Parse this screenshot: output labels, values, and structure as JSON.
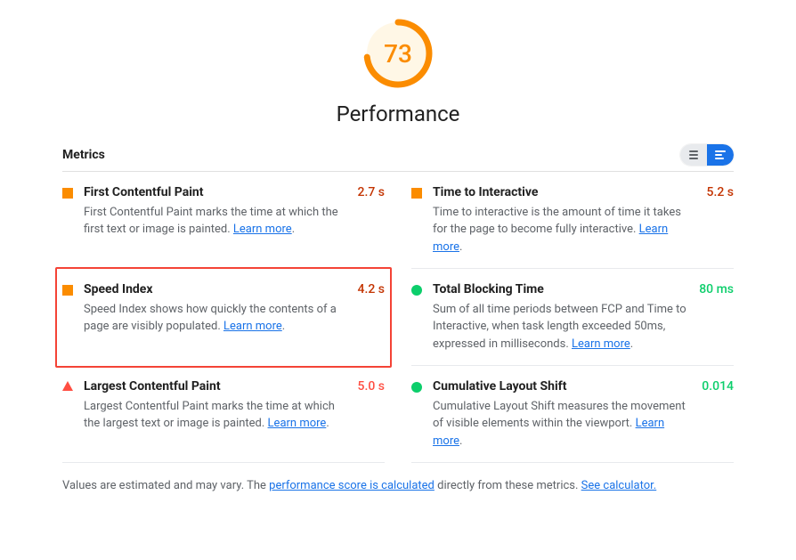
{
  "score": {
    "value": 73,
    "color": "#fb8c00",
    "pct": 0.73
  },
  "title": "Performance",
  "metrics_label": "Metrics",
  "learn_more": "Learn more",
  "metrics": [
    {
      "title": "First Contentful Paint",
      "desc": "First Contentful Paint marks the time at which the first text or image is painted. ",
      "value": "2.7 s",
      "status": "average",
      "highlight": false
    },
    {
      "title": "Time to Interactive",
      "desc": "Time to interactive is the amount of time it takes for the page to become fully interactive. ",
      "value": "5.2 s",
      "status": "average",
      "highlight": false
    },
    {
      "title": "Speed Index",
      "desc": "Speed Index shows how quickly the contents of a page are visibly populated. ",
      "value": "4.2 s",
      "status": "average",
      "highlight": true
    },
    {
      "title": "Total Blocking Time",
      "desc": "Sum of all time periods between FCP and Time to Interactive, when task length exceeded 50ms, expressed in milliseconds. ",
      "value": "80 ms",
      "status": "pass",
      "highlight": false
    },
    {
      "title": "Largest Contentful Paint",
      "desc": "Largest Contentful Paint marks the time at which the largest text or image is painted. ",
      "value": "5.0 s",
      "status": "fail",
      "highlight": false
    },
    {
      "title": "Cumulative Layout Shift",
      "desc": "Cumulative Layout Shift measures the movement of visible elements within the viewport. ",
      "value": "0.014",
      "status": "pass",
      "highlight": false
    }
  ],
  "footnote": {
    "pre": "Values are estimated and may vary. The ",
    "link1": "performance score is calculated",
    "mid": " directly from these metrics. ",
    "link2": "See calculator."
  }
}
